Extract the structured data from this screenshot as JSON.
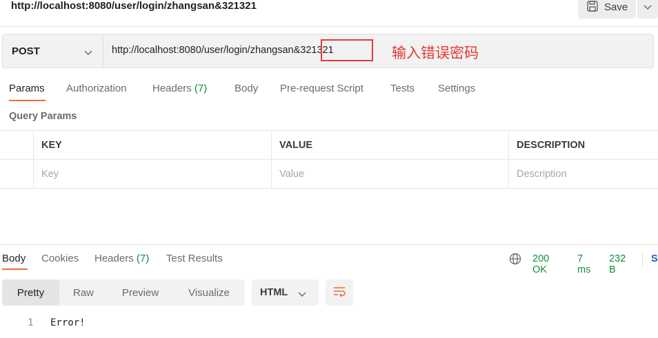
{
  "request": {
    "title": "http://localhost:8080/user/login/zhangsan&321321",
    "save_label": "Save",
    "method": "POST",
    "url": "http://localhost:8080/user/login/zhangsan&321321",
    "annotation": "输入错误密码"
  },
  "request_tabs": [
    {
      "label": "Params",
      "count": ""
    },
    {
      "label": "Authorization",
      "count": ""
    },
    {
      "label": "Headers",
      "count": "(7)"
    },
    {
      "label": "Body",
      "count": ""
    },
    {
      "label": "Pre-request Script",
      "count": ""
    },
    {
      "label": "Tests",
      "count": ""
    },
    {
      "label": "Settings",
      "count": ""
    }
  ],
  "query_params": {
    "title": "Query Params",
    "headers": [
      "KEY",
      "VALUE",
      "DESCRIPTION"
    ],
    "placeholders": [
      "Key",
      "Value",
      "Description"
    ]
  },
  "response_tabs": [
    {
      "label": "Body",
      "count": ""
    },
    {
      "label": "Cookies",
      "count": ""
    },
    {
      "label": "Headers",
      "count": "(7)"
    },
    {
      "label": "Test Results",
      "count": ""
    }
  ],
  "status": {
    "code": "200 OK",
    "time": "7 ms",
    "size": "232 B",
    "truncated_label": "S"
  },
  "view_modes": [
    "Pretty",
    "Raw",
    "Preview",
    "Visualize"
  ],
  "format": "HTML",
  "response_body": [
    {
      "line": "1",
      "text": "Error!"
    }
  ],
  "colors": {
    "accent": "#f26b3a",
    "status_green": "#0f8f3c",
    "annotation_red": "#e53935"
  }
}
